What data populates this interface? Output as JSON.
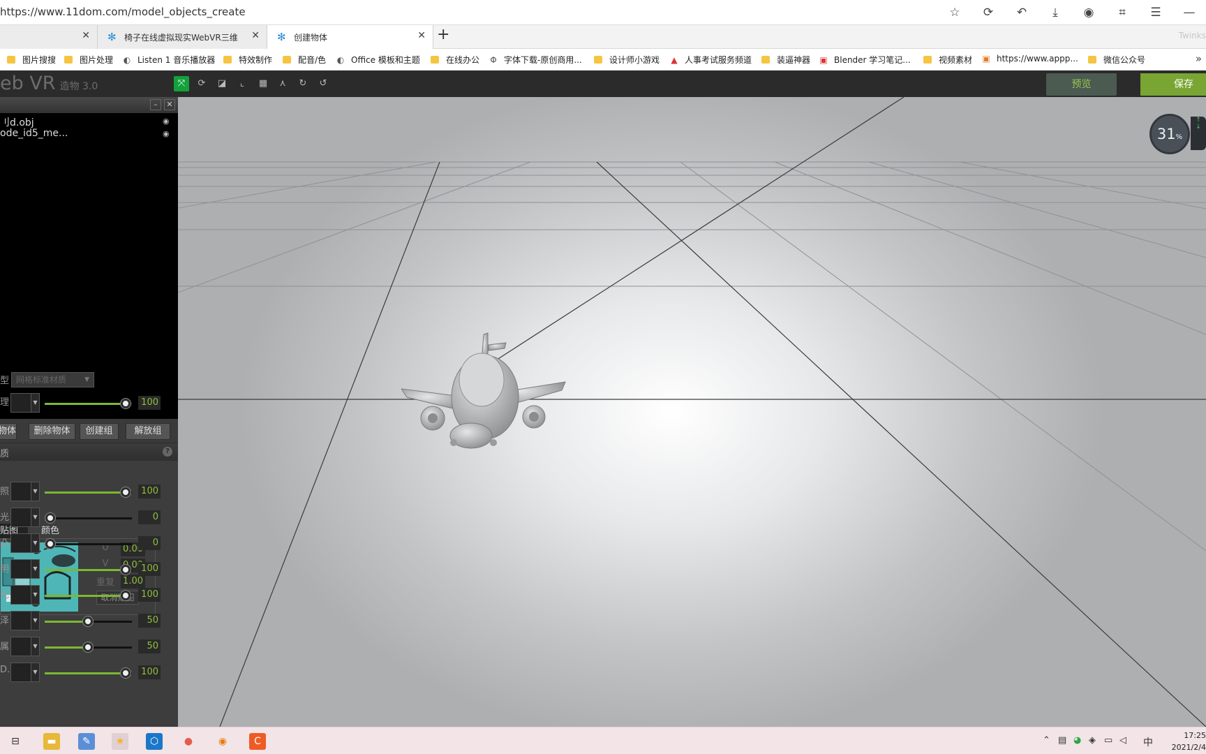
{
  "browser": {
    "url": "https://www.11dom.com/model_objects_create",
    "tabs": [
      {
        "label": "",
        "active": false
      },
      {
        "label": "椅子在线虚拟现实WebVR三维",
        "active": false
      },
      {
        "label": "创建物体",
        "active": true
      }
    ],
    "faded_label": "Twinks",
    "bookmarks": [
      "图片搜搜",
      "图片处理",
      "Listen 1 音乐播放器",
      "特效制作",
      "配音/色",
      "Office 模板和主题",
      "在线办公",
      "字体下载-原创商用...",
      "设计师小游戏",
      "人事考试服务频道",
      "装逼神器",
      "Blender 学习笔记...",
      "视频素材",
      "https://www.appp...",
      "微信公众号"
    ]
  },
  "app": {
    "logo": "eb VR",
    "logo_sub": "造物 3.0",
    "preview_label": "预览",
    "save_label": "保存"
  },
  "panel": {
    "objects": [
      {
        "name": "刂d.obj"
      },
      {
        "name": "ode_id5_me..."
      }
    ],
    "actions": [
      "物体",
      "删除物体",
      "创建组",
      "解放组"
    ],
    "section_title": "质",
    "help": "?",
    "type_label": "型",
    "material_select": "网格标准材质",
    "texture_label": "理",
    "texture_value": "100",
    "texture_slider": 1.0,
    "subtabs": [
      "贴图",
      "颜色"
    ],
    "uv": {
      "u_label": "U",
      "u": "0.00",
      "v_label": "V",
      "v": "0.00",
      "repeat_label": "重复",
      "repeat": "1.00",
      "unmap_label": "取消贴图"
    },
    "sliders": [
      {
        "label": "照",
        "value": "100",
        "level": 1.0
      },
      {
        "label": "光",
        "value": "0",
        "level": 0.0
      },
      {
        "label": "凸",
        "value": "0",
        "level": 0.0
      },
      {
        "label": "明",
        "value": "100",
        "level": 1.0
      },
      {
        "label": "光",
        "value": "100",
        "level": 1.0
      },
      {
        "label": "泽",
        "value": "50",
        "level": 0.5
      },
      {
        "label": "属",
        "value": "50",
        "level": 0.5
      },
      {
        "label": "D.",
        "value": "100",
        "level": 1.0
      }
    ]
  },
  "viewport": {
    "fps": "31",
    "fps_unit": "%"
  },
  "taskbar": {
    "ime": "中",
    "time": "17:25",
    "date": "2021/2/4"
  }
}
